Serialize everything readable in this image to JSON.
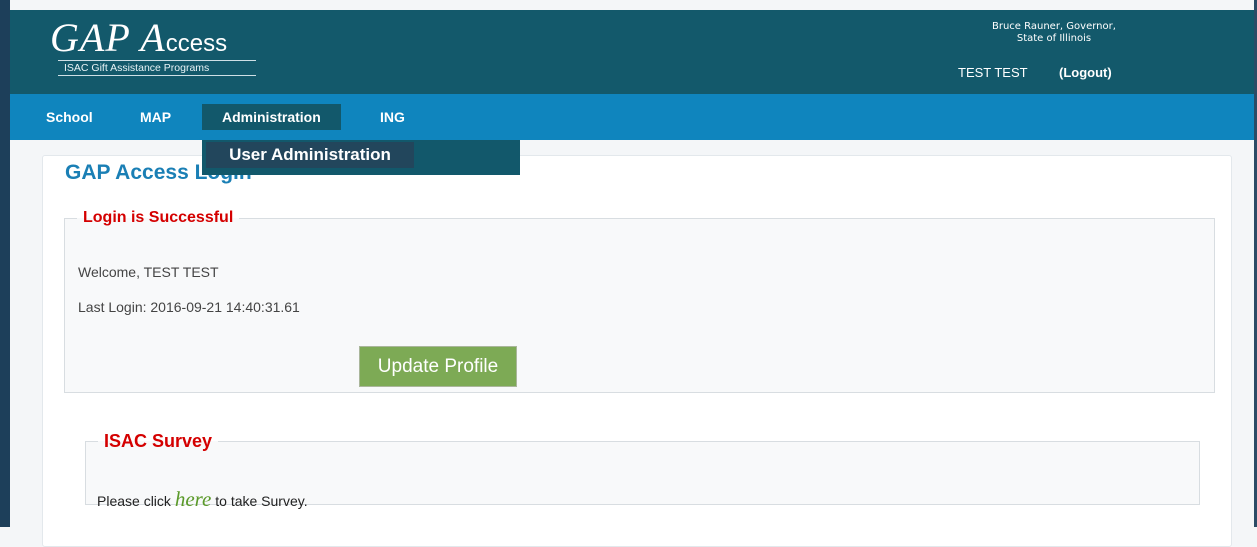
{
  "header": {
    "logo_main": "GAP A",
    "logo_rest": "ccess",
    "logo_tagline": "ISAC Gift Assistance Programs",
    "governor_line1": "Bruce Rauner, Governor,",
    "governor_line2": "State of Illinois",
    "user_name": "TEST TEST",
    "logout_label": "(Logout)"
  },
  "nav": {
    "items": [
      {
        "label": "School"
      },
      {
        "label": "MAP"
      },
      {
        "label": "Administration"
      },
      {
        "label": "ING"
      }
    ],
    "active_index": 2,
    "dropdown": {
      "items": [
        {
          "label": "User Administration"
        }
      ]
    }
  },
  "main": {
    "title": "GAP Access Login",
    "login_section": {
      "legend": "Login is Successful",
      "welcome": "Welcome, TEST TEST",
      "last_login": "Last Login: 2016-09-21 14:40:31.61",
      "update_button": "Update Profile"
    },
    "survey_section": {
      "legend": "ISAC Survey",
      "text_before": "Please click ",
      "link": "here",
      "text_after": " to take Survey."
    }
  },
  "colors": {
    "header_bg": "#13596b",
    "nav_bg": "#0f85be",
    "title": "#1a7fb5",
    "legend": "#d40000",
    "button": "#7daa55",
    "link": "#5b9a2a"
  }
}
